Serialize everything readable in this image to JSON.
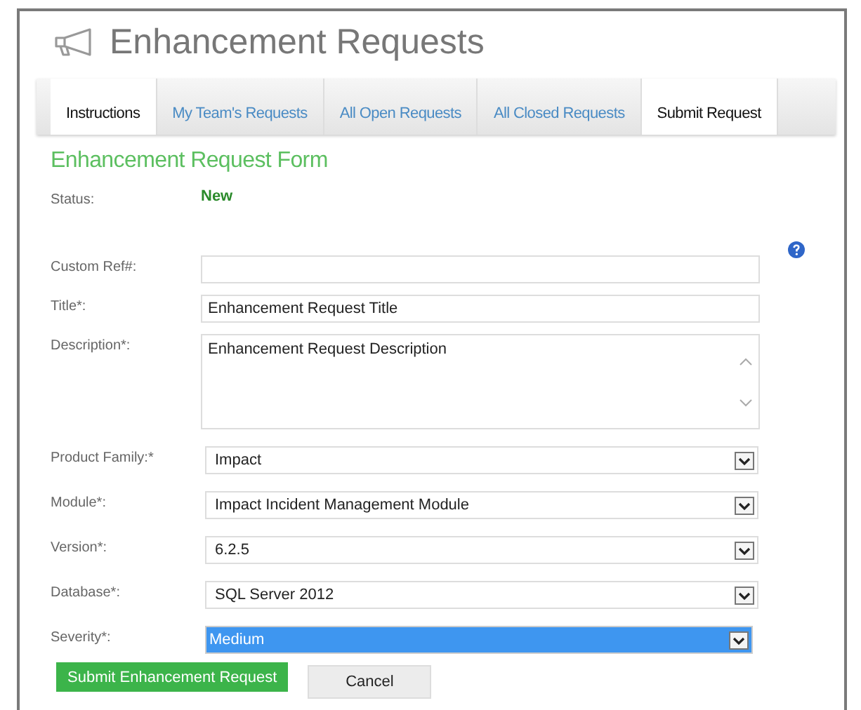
{
  "page_title": "Enhancement Requests",
  "tabs": [
    {
      "label": "Instructions",
      "selected": true
    },
    {
      "label": "My Team's Requests",
      "selected": false
    },
    {
      "label": "All Open Requests",
      "selected": false
    },
    {
      "label": "All Closed Requests",
      "selected": false
    },
    {
      "label": "Submit Request",
      "selected": true
    }
  ],
  "form": {
    "title": "Enhancement Request Form",
    "status": {
      "label": "Status:",
      "value": "New"
    },
    "fields": [
      {
        "kind": "text",
        "label": "Custom Ref#:",
        "help": true
      },
      {
        "kind": "text",
        "label": "Title*:",
        "value": "Enhancement Request Title"
      },
      {
        "kind": "textarea",
        "label": "Description*:",
        "value": "Enhancement Request Description"
      },
      {
        "kind": "select",
        "label": "Product Family:*",
        "value": "Impact",
        "highlighted": false
      },
      {
        "kind": "select",
        "label": "Module*:",
        "value": "Impact Incident Management Module",
        "highlighted": false
      },
      {
        "kind": "select",
        "label": "Version*:",
        "value": "6.2.5",
        "highlighted": false
      },
      {
        "kind": "select",
        "label": "Database*:",
        "value": "SQL Server 2012",
        "highlighted": false
      },
      {
        "kind": "select",
        "label": "Severity*:",
        "value": "Medium",
        "highlighted": true
      }
    ],
    "buttons": [
      {
        "kind": "primary",
        "label": "Submit Enhancement Request"
      },
      {
        "kind": "secondary",
        "label": "Cancel"
      }
    ]
  }
}
